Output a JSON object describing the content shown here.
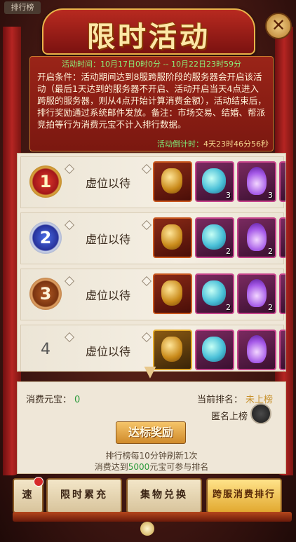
{
  "bg_tab": "排行榜",
  "title": "限时活动",
  "close_icon": "close-icon",
  "activity_time": "活动时间：10月17日0时0分 -- 10月22日23时59分",
  "description": "开启条件：活动期间达到8服跨服阶段的服务器会开启该活动（最后1天达到的服务器不开启、活动开启当天4点进入跨服的服务器，则从4点开始计算消费金额），活动结束后，排行奖励通过系统邮件发放。备注：市场交易、结婚、帮派竞拍等行为消费元宝不计入排行数据。",
  "countdown_label": "活动倒计时：",
  "countdown_value": "4天23时46分56秒",
  "ranks": [
    {
      "medal": "1",
      "name": "虚位以待",
      "rewards": [
        {
          "type": "token",
          "count": ""
        },
        {
          "type": "jade",
          "count": "3"
        },
        {
          "type": "flame",
          "count": "3"
        }
      ]
    },
    {
      "medal": "2",
      "name": "虚位以待",
      "rewards": [
        {
          "type": "token",
          "count": ""
        },
        {
          "type": "jade",
          "count": "2"
        },
        {
          "type": "flame",
          "count": "2"
        }
      ]
    },
    {
      "medal": "3",
      "name": "虚位以待",
      "rewards": [
        {
          "type": "token",
          "count": ""
        },
        {
          "type": "jade",
          "count": "2"
        },
        {
          "type": "flame",
          "count": "2"
        }
      ]
    },
    {
      "medal": "4",
      "name": "虚位以待",
      "rewards": [
        {
          "type": "token",
          "count": ""
        },
        {
          "type": "jade",
          "count": ""
        },
        {
          "type": "flame",
          "count": ""
        }
      ]
    }
  ],
  "consumed_label": "消费元宝：",
  "consumed_value": "0",
  "current_rank_label": "当前排名：",
  "current_rank_value": "未上榜",
  "anonymous_label": "匿名上榜",
  "reward_button": "达标奖励",
  "note1": "排行榜每10分钟刷新1次",
  "note2_pre": "消费达到",
  "note2_amount": "5000",
  "note2_post": "元宝可参与排名",
  "tabs": [
    "速",
    "限时累充",
    "集物兑换",
    "跨服消费排行"
  ]
}
